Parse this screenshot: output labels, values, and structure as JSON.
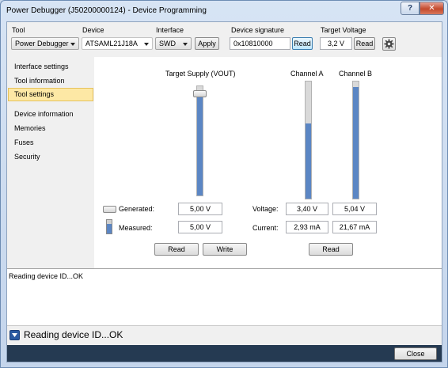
{
  "window": {
    "title": "Power Debugger (J50200000124) - Device Programming",
    "help_label": "?",
    "close_label": "✕"
  },
  "toolbar": {
    "tool": {
      "label": "Tool",
      "value": "Power Debugger"
    },
    "device": {
      "label": "Device",
      "value": "ATSAML21J18A"
    },
    "interface": {
      "label": "Interface",
      "value": "SWD",
      "apply_label": "Apply"
    },
    "device_signature": {
      "label": "Device signature",
      "value": "0x10810000",
      "read_label": "Read"
    },
    "target_voltage": {
      "label": "Target Voltage",
      "value": "3,2 V",
      "read_label": "Read"
    },
    "settings_icon": "gear-icon"
  },
  "nav": {
    "items": [
      {
        "label": "Interface settings",
        "selected": false
      },
      {
        "label": "Tool information",
        "selected": false
      },
      {
        "label": "Tool settings",
        "selected": true
      },
      {
        "label": "Device information",
        "selected": false
      },
      {
        "label": "Memories",
        "selected": false
      },
      {
        "label": "Fuses",
        "selected": false
      },
      {
        "label": "Security",
        "selected": false
      }
    ]
  },
  "tool_settings": {
    "target_supply_title": "Target Supply (VOUT)",
    "target_supply_level": 0.94,
    "channel_a_title": "Channel A",
    "channel_a_level": 0.64,
    "channel_b_title": "Channel B",
    "channel_b_level": 0.95,
    "generated_label": "Generated:",
    "generated_value": "5,00 V",
    "measured_label": "Measured:",
    "measured_value": "5,00 V",
    "voltage_label": "Voltage:",
    "channel_a_voltage": "3,40 V",
    "channel_b_voltage": "5,04 V",
    "current_label": "Current:",
    "channel_a_current": "2,93 mA",
    "channel_b_current": "21,67 mA",
    "read_label": "Read",
    "write_label": "Write",
    "channels_read_label": "Read"
  },
  "log": {
    "text": "Reading device ID...OK"
  },
  "status": {
    "text": "Reading device ID...OK"
  },
  "footer": {
    "close_label": "Close"
  },
  "colors": {
    "bar_fill": "#5b86c4",
    "selected_nav": "#fde8a5",
    "footer_bar": "#253a52"
  }
}
